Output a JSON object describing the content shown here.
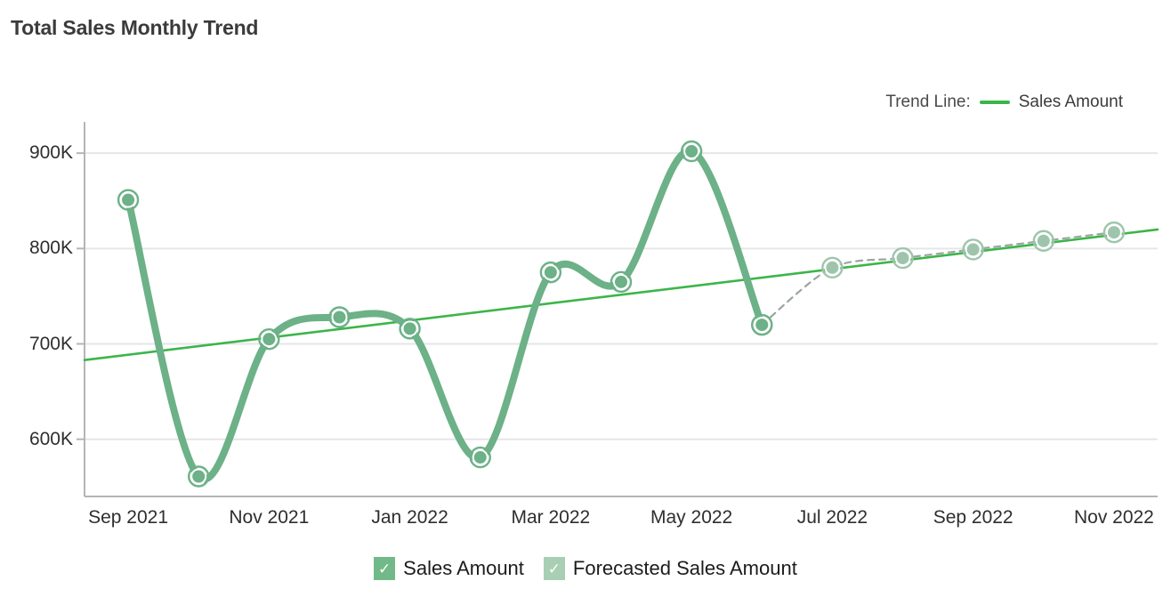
{
  "chart_title": "Total Sales Monthly Trend",
  "trend_legend": {
    "label": "Trend Line:",
    "series_name": "Sales Amount",
    "swatch_color": "#3cb54a"
  },
  "bottom_legend": {
    "items": [
      {
        "label": "Sales Amount",
        "checked": "✓",
        "box_color": "#72b98a"
      },
      {
        "label": "Forecasted Sales Amount",
        "checked": "✓",
        "box_color": "#a8cfb4"
      }
    ]
  },
  "colors": {
    "actual_line": "#6cb187",
    "forecast_line": "#9aa5a0",
    "trend_line": "#3cb54a",
    "marker_fill": "#6cb187",
    "marker_ring": "#ffffff",
    "marker_outer": "#6cb187",
    "forecast_marker_fill": "#9ec5ac",
    "forecast_marker_outer": "#9ec5ac",
    "gridline": "#e6e6e6",
    "axis": "#b5b5b5",
    "text": "#2e2e2e",
    "title": "#3b3b3b"
  },
  "chart_data": {
    "type": "line",
    "title": "Total Sales Monthly Trend",
    "xlabel": "",
    "ylabel": "",
    "ylim": [
      540000,
      930000
    ],
    "y_ticks": [
      600000,
      700000,
      800000,
      900000
    ],
    "y_tick_labels": [
      "600K",
      "700K",
      "800K",
      "900K"
    ],
    "grid": "horizontal",
    "legend_position": "bottom",
    "x": [
      "Sep 2021",
      "Oct 2021",
      "Nov 2021",
      "Dec 2021",
      "Jan 2022",
      "Feb 2022",
      "Mar 2022",
      "Apr 2022",
      "May 2022",
      "Jun 2022",
      "Jul 2022",
      "Aug 2022",
      "Sep 2022",
      "Oct 2022",
      "Nov 2022"
    ],
    "x_tick_labels": [
      "Sep 2021",
      "Nov 2021",
      "Jan 2022",
      "Mar 2022",
      "May 2022",
      "Jul 2022",
      "Sep 2022",
      "Nov 2022"
    ],
    "series": [
      {
        "name": "Sales Amount",
        "style": "solid",
        "values": [
          851000,
          561000,
          705000,
          728000,
          716000,
          581000,
          775000,
          765000,
          902000,
          720000,
          null,
          null,
          null,
          null,
          null
        ]
      },
      {
        "name": "Forecasted Sales Amount",
        "style": "dashed",
        "values": [
          null,
          null,
          null,
          null,
          null,
          null,
          null,
          null,
          null,
          720000,
          780000,
          790000,
          799000,
          808000,
          817000
        ]
      },
      {
        "name": "Trend Line: Sales Amount",
        "style": "straight",
        "values": [
          683000,
          693000,
          703000,
          713000,
          723000,
          733000,
          743000,
          753000,
          763000,
          773000,
          783000,
          793000,
          803000,
          812000,
          820000
        ]
      }
    ]
  }
}
